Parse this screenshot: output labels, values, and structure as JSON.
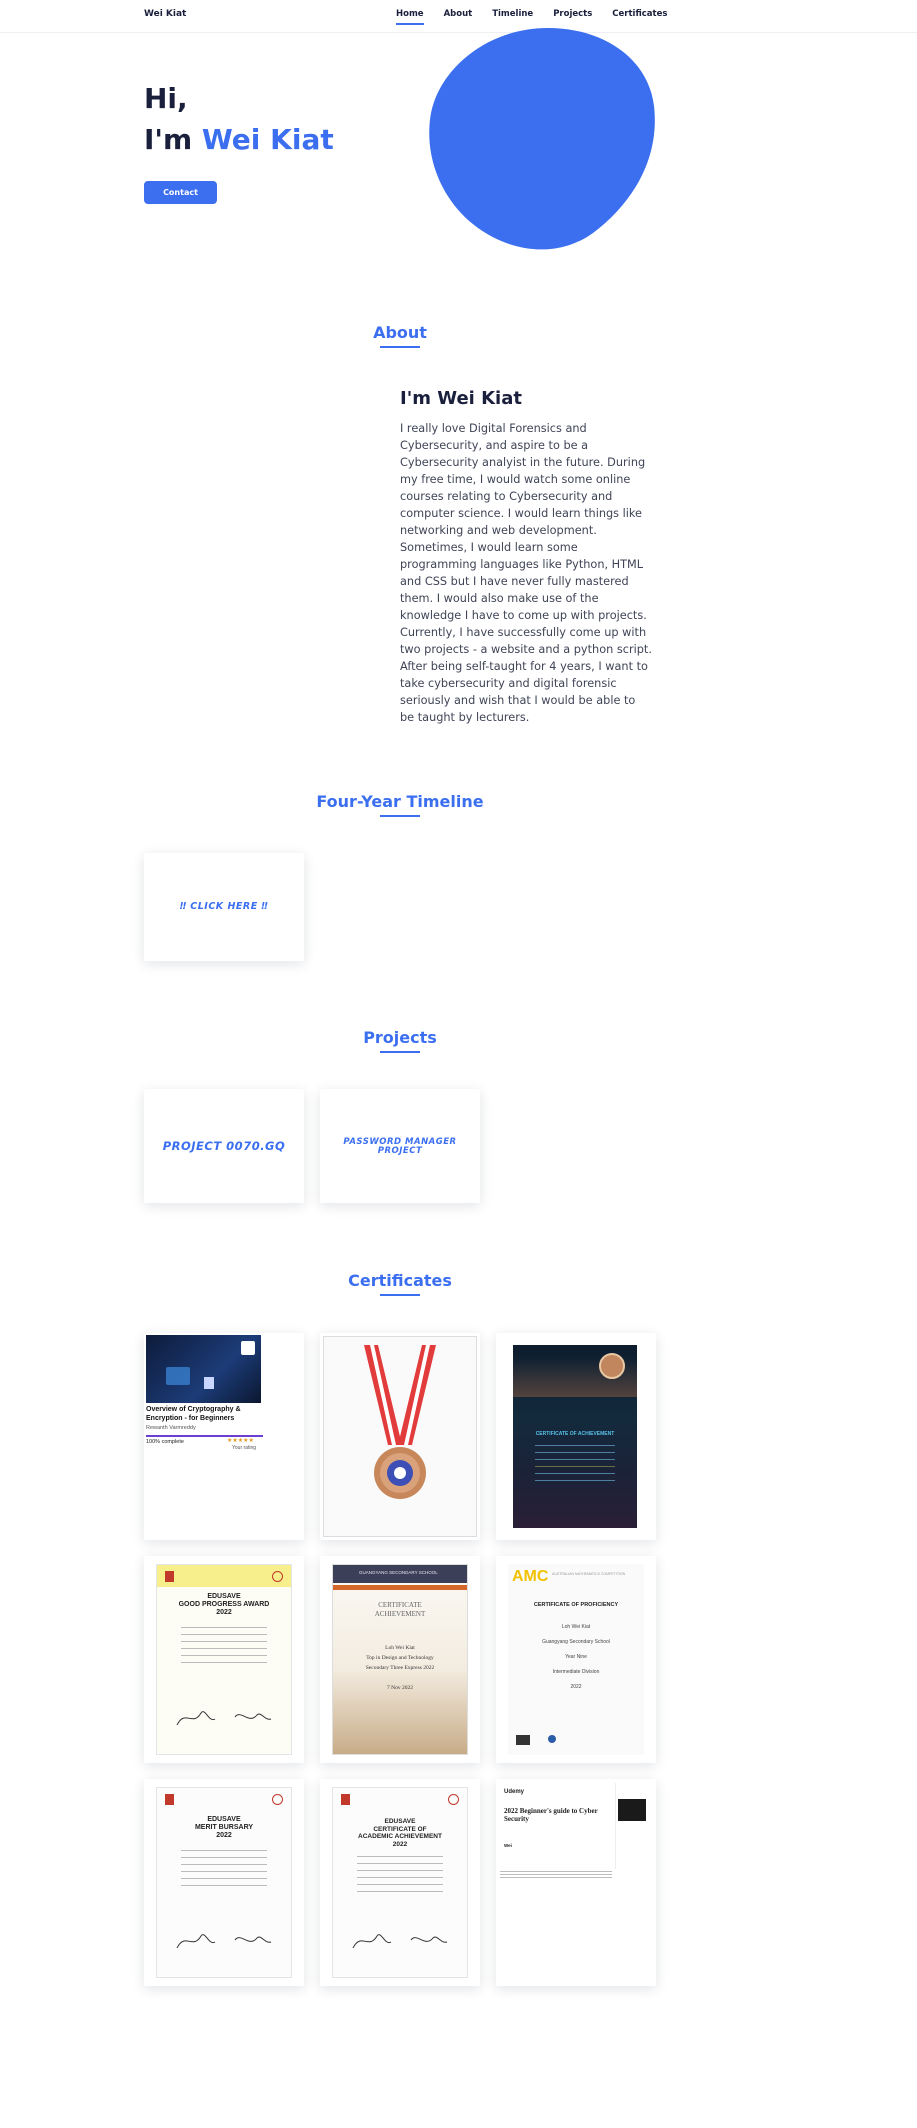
{
  "header": {
    "logo": "Wei Kiat",
    "nav": [
      "Home",
      "About",
      "Timeline",
      "Projects",
      "Certificates"
    ]
  },
  "hero": {
    "line1": "Hi,",
    "line2_prefix": "I'm ",
    "line2_name": "Wei Kiat",
    "contact_label": "Contact"
  },
  "about": {
    "section_title": "About",
    "heading": "I'm Wei Kiat",
    "text": "I really love Digital Forensics and Cybersecurity, and aspire to be a Cybersecurity analyist in the future. During my free time, I would watch some online courses relating to Cybersecurity and computer science. I would learn things like networking and web development. Sometimes, I would learn some programming languages like Python, HTML and CSS but I have never fully mastered them. I would also make use of the knowledge I have to come up with projects. Currently, I have successfully come up with two projects - a website and a python script. After being self-taught for 4 years, I want to take cybersecurity and digital forensic seriously and wish that I would be able to be taught by lecturers."
  },
  "timeline": {
    "section_title": "Four-Year Timeline",
    "card_label": "‼ CLICK HERE ‼"
  },
  "projects": {
    "section_title": "Projects",
    "items": [
      "PROJECT 0070.GQ",
      "PASSWORD MANAGER PROJECT"
    ]
  },
  "certificates": {
    "section_title": "Certificates",
    "udemy": {
      "course": "Overview of Cryptography & Encryption - for Beginners",
      "author": "Rewanth Varmreddy",
      "progress": "100% complete",
      "stars": "★★★★★",
      "rating_label": "Your rating"
    },
    "achievement": {
      "title": "CERTIFICATE OF ACHIEVEMENT"
    },
    "good_progress": {
      "line1": "EDUSAVE",
      "line2": "GOOD PROGRESS AWARD",
      "line3": "2022"
    },
    "dt_cert": {
      "school": "GUANGYANG SECONDARY SCHOOL",
      "line1": "CERTIFICATE",
      "line2": "ACHIEVEMENT",
      "name": "Loh Wei Kiat",
      "subject": "Top in Design and Technology",
      "level": "Secondary Three Express 2022",
      "date": "7 Nov 2022"
    },
    "amc": {
      "logo": "AMC",
      "org": "AUSTRALIAN MATHEMATICS COMPETITION",
      "title": "CERTIFICATE OF PROFICIENCY",
      "name": "Loh Wei Kiat",
      "school": "Guangyang Secondary School",
      "year_level": "Year Nine",
      "division": "Intermediate Division",
      "year": "2022"
    },
    "merit": {
      "line1": "EDUSAVE",
      "line2": "MERIT BURSARY",
      "line3": "2022"
    },
    "academic": {
      "line1": "EDUSAVE",
      "line2": "CERTIFICATE OF",
      "line3": "ACADEMIC ACHIEVEMENT",
      "line4": "2022"
    },
    "udemy2": {
      "brand": "Udemy",
      "title": "2022 Beginner's guide to Cyber Security",
      "name": "Wei"
    }
  },
  "colors": {
    "accent": "#3b6ff0",
    "dark": "#1a1f3c"
  }
}
